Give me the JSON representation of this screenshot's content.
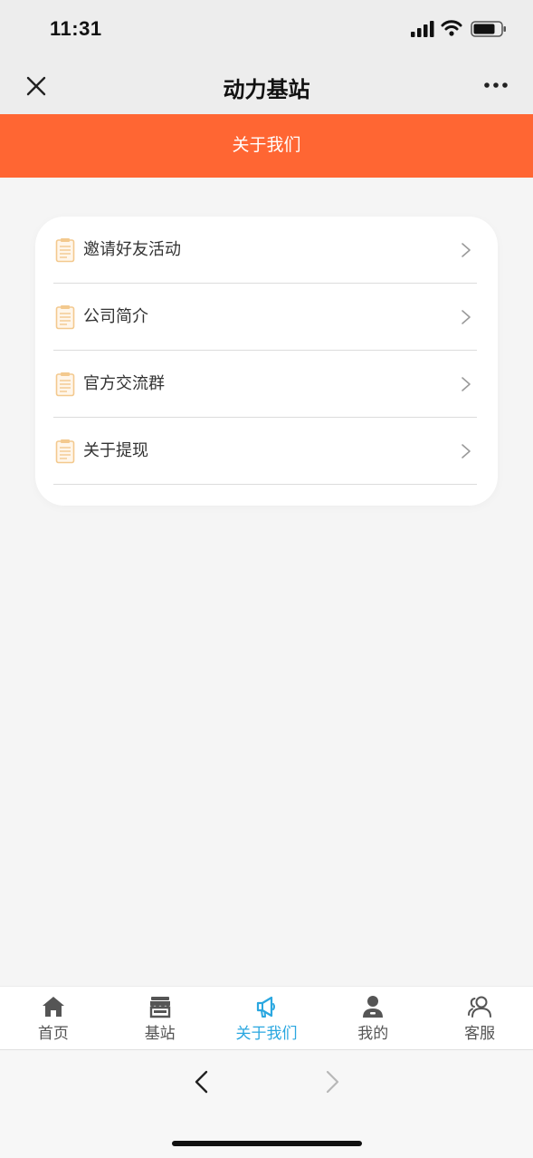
{
  "status_bar": {
    "time": "11:31",
    "icons": [
      "cellular-signal-icon",
      "wifi-icon",
      "battery-icon"
    ]
  },
  "nav": {
    "title": "动力基站",
    "left_icon": "close-icon",
    "right_icon": "more-icon"
  },
  "header": {
    "title": "关于我们"
  },
  "menu": {
    "items": [
      {
        "label": "邀请好友活动",
        "icon": "clipboard-icon"
      },
      {
        "label": "公司简介",
        "icon": "clipboard-icon"
      },
      {
        "label": "官方交流群",
        "icon": "clipboard-icon"
      },
      {
        "label": "关于提现",
        "icon": "clipboard-icon"
      }
    ]
  },
  "tabbar": {
    "tabs": [
      {
        "label": "首页",
        "icon": "home-icon",
        "active": false
      },
      {
        "label": "基站",
        "icon": "store-icon",
        "active": false
      },
      {
        "label": "关于我们",
        "icon": "megaphone-icon",
        "active": true
      },
      {
        "label": "我的",
        "icon": "user-icon",
        "active": false
      },
      {
        "label": "客服",
        "icon": "customer-service-icon",
        "active": false
      }
    ]
  },
  "browser": {
    "back_icon": "chevron-left-icon",
    "forward_icon": "chevron-right-icon"
  },
  "colors": {
    "header_orange": "#ff6633",
    "tab_active": "#2aa7e0",
    "tab_inactive": "#555555",
    "page_bg": "#f5f5f5",
    "menu_icon": "#f3c98e"
  }
}
